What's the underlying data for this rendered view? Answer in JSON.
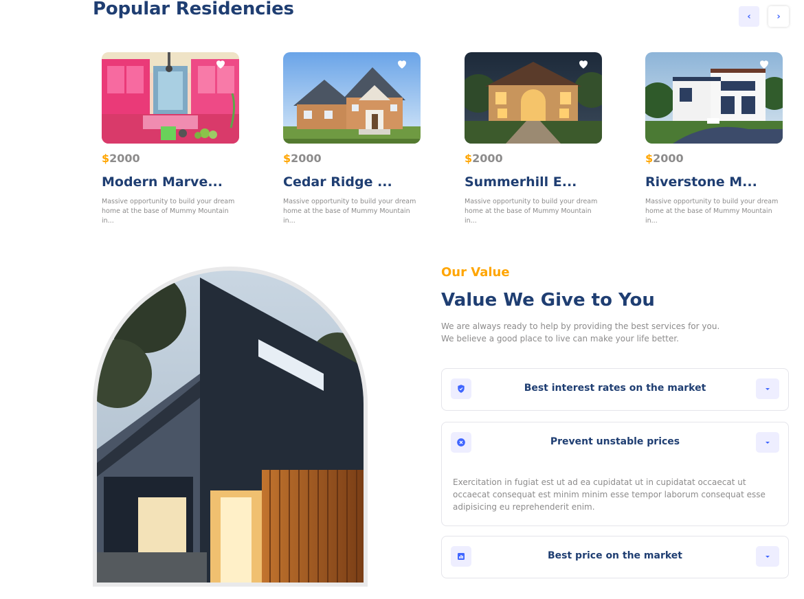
{
  "residencies": {
    "title": "Popular Residencies",
    "nav": {
      "prev_icon": "chevron-left-icon",
      "next_icon": "chevron-right-icon",
      "prev_glyph": "‹",
      "next_glyph": "›"
    },
    "cards": [
      {
        "currency": "$",
        "price": "2000",
        "name": "Modern Marve...",
        "description": "Massive opportunity to build your dream home at the base of Mummy Mountain in...",
        "image": "pink-kitchen-photo"
      },
      {
        "currency": "$",
        "price": "2000",
        "name": "Cedar Ridge ...",
        "description": "Massive opportunity to build your dream home at the base of Mummy Mountain in...",
        "image": "suburban-house-photo"
      },
      {
        "currency": "$",
        "price": "2000",
        "name": "Summerhill E...",
        "description": "Massive opportunity to build your dream home at the base of Mummy Mountain in...",
        "image": "lit-villa-photo"
      },
      {
        "currency": "$",
        "price": "2000",
        "name": "Riverstone M...",
        "description": "Massive opportunity to build your dream home at the base of Mummy Mountain in...",
        "image": "modern-white-house-photo"
      }
    ]
  },
  "value": {
    "eyebrow": "Our Value",
    "title": "Value We Give to You",
    "subtitle_line1": "We are always ready to help by providing the best services for you.",
    "subtitle_line2": "We believe a good place to live can make your life better.",
    "items": [
      {
        "icon": "shield-check-icon",
        "title": "Best interest rates on the market",
        "expanded": false,
        "detail": ""
      },
      {
        "icon": "close-circle-icon",
        "title": "Prevent unstable prices",
        "expanded": true,
        "detail": "Exercitation in fugiat est ut ad ea cupidatat ut in cupidatat occaecat ut occaecat consequat est minim minim esse tempor laborum consequat esse adipisicing eu reprehenderit enim."
      },
      {
        "icon": "bar-chart-icon",
        "title": "Best price on the market",
        "expanded": false,
        "detail": ""
      }
    ]
  },
  "colors": {
    "primary": "#1f3e72",
    "accent": "#ffa500",
    "blue": "#4066ff",
    "muted": "#8c8b8b",
    "soft_bg": "#eeeeff"
  }
}
